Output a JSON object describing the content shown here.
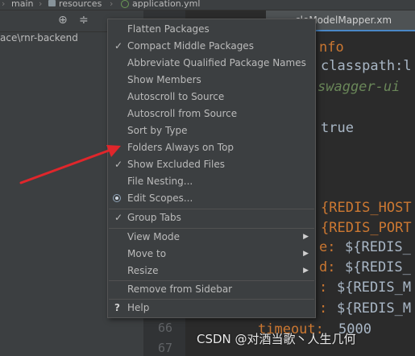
{
  "breadcrumb": {
    "items": [
      "main",
      "resources",
      "application.yml"
    ]
  },
  "project_panel": {
    "path": "ace\\rnr-backend",
    "icons": [
      "target-icon",
      "collapse-icon"
    ]
  },
  "editor": {
    "tab_title": "cleModelMapper.xm",
    "line_numbers": [
      "66",
      "67"
    ],
    "code": {
      "info": "nfo",
      "classpath": "classpath:l",
      "swagger": "swagger-ui",
      "true": "true",
      "redis_host": "{REDIS_HOST",
      "redis_port": "{REDIS_PORT",
      "line_e_key": "e:",
      "line_e_val": "${REDIS_",
      "line_d_key": "d:",
      "line_d_val": "${REDIS_",
      "line_m1_key": ":",
      "line_m1_val": "${REDIS_M",
      "line_m2_key": ":",
      "line_m2_val": "${REDIS_M",
      "timeout_key": "timeout:",
      "timeout_val": "5000"
    }
  },
  "menu": {
    "items": [
      {
        "label": "Flatten Packages"
      },
      {
        "label": "Compact Middle Packages",
        "checked": "✓"
      },
      {
        "label": "Abbreviate Qualified Package Names"
      },
      {
        "label": "Show Members"
      },
      {
        "label": "Autoscroll to Source"
      },
      {
        "label": "Autoscroll from Source"
      },
      {
        "label": "Sort by Type"
      },
      {
        "label": "Folders Always on Top"
      },
      {
        "label": "Show Excluded Files",
        "checked": "✓"
      },
      {
        "label": "File Nesting..."
      },
      {
        "label": "Edit Scopes..."
      },
      {
        "label": "Group Tabs",
        "checked": "✓"
      },
      {
        "label": "View Mode",
        "arrow": "▶"
      },
      {
        "label": "Move to",
        "arrow": "▶"
      },
      {
        "label": "Resize",
        "arrow": "▶"
      },
      {
        "label": "Remove from Sidebar"
      },
      {
        "label": "Help",
        "icon": "?"
      }
    ]
  },
  "watermark": "CSDN @对酒当歌丶人生几何",
  "colors": {
    "annotation_arrow": "#e0262b",
    "menu_bg": "#3c3f41",
    "editor_bg": "#2b2b2b"
  }
}
